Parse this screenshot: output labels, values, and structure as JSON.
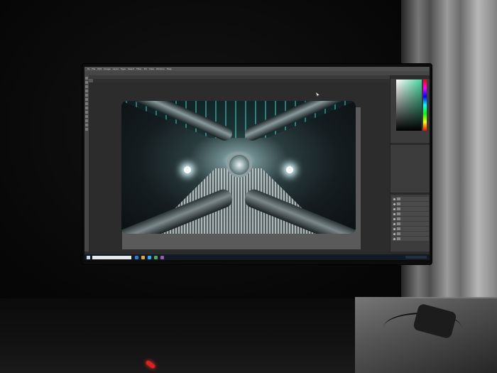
{
  "scene": {
    "description_tags": [
      "dark-room",
      "monitor",
      "photo-editor",
      "sci-fi-corridor"
    ],
    "colors": {
      "accent": "#44c5bd",
      "led": "#e0201a",
      "screen_bg": "#3a3a3a"
    }
  },
  "app": {
    "menu_items": [
      "Ps",
      "File",
      "Edit",
      "Image",
      "Layer",
      "Type",
      "Select",
      "Filter",
      "3D",
      "View",
      "Window",
      "Help"
    ],
    "document_tab": "",
    "status_text": ""
  },
  "icons": [
    "cursor-icon",
    "eye-icon",
    "start-icon",
    "search-icon"
  ]
}
